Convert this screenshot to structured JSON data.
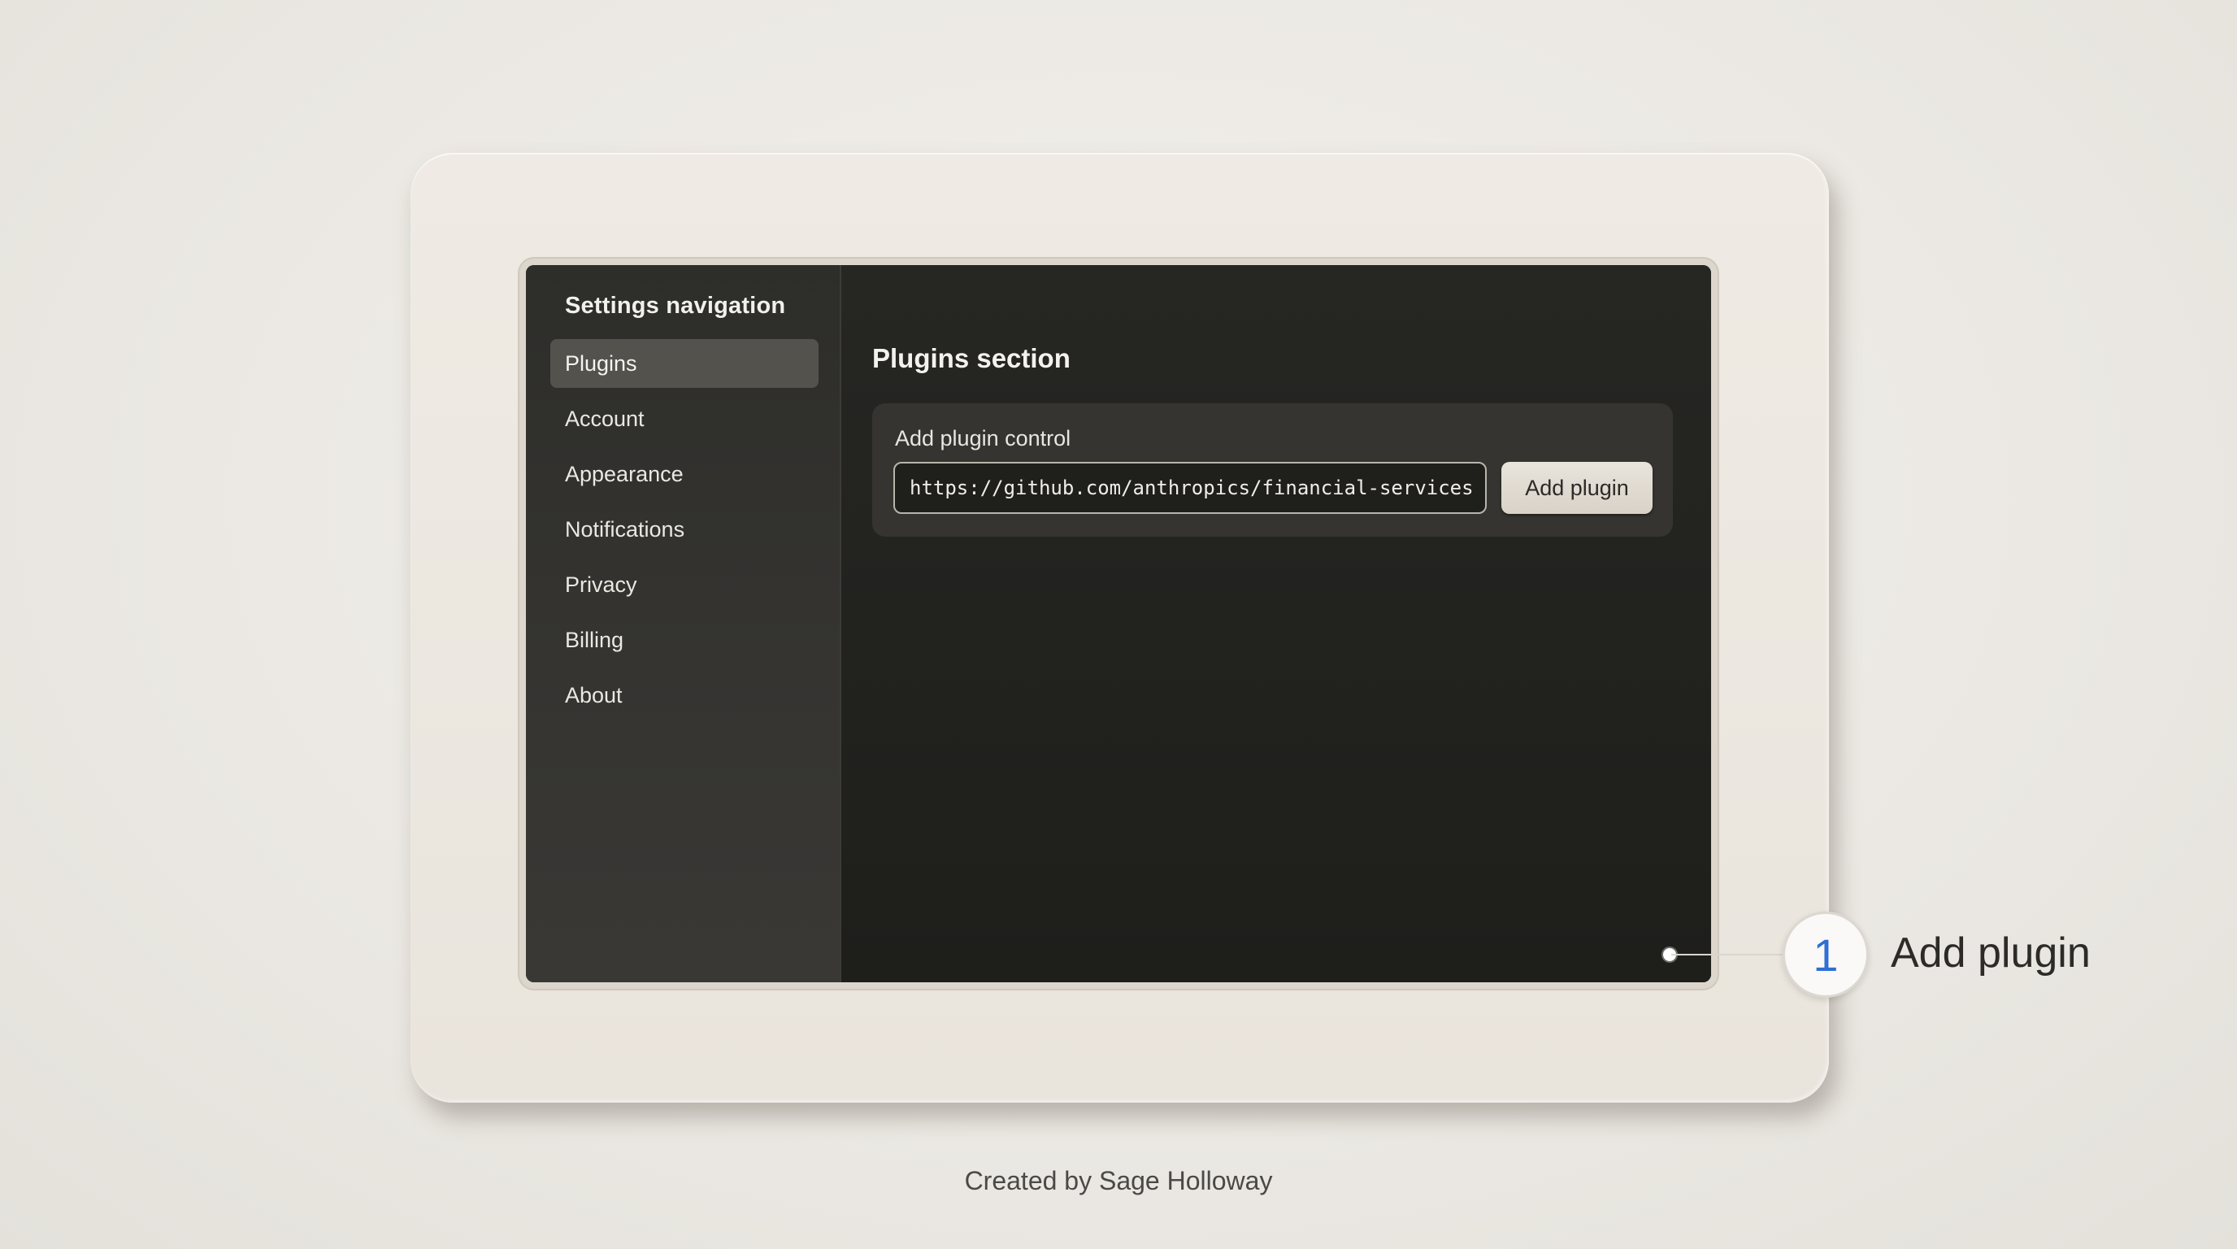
{
  "sidebar": {
    "title": "Settings navigation",
    "items": [
      {
        "label": "Plugins",
        "active": true
      },
      {
        "label": "Account",
        "active": false
      },
      {
        "label": "Appearance",
        "active": false
      },
      {
        "label": "Notifications",
        "active": false
      },
      {
        "label": "Privacy",
        "active": false
      },
      {
        "label": "Billing",
        "active": false
      },
      {
        "label": "About",
        "active": false
      }
    ]
  },
  "main": {
    "section_title": "Plugins section",
    "control": {
      "label": "Add plugin control",
      "input_value": "https://github.com/anthropics/financial-services",
      "button_label": "Add plugin"
    }
  },
  "callout": {
    "number": "1",
    "label": "Add plugin",
    "number_color": "#2f6fd6"
  },
  "credit": "Created by Sage Holloway"
}
